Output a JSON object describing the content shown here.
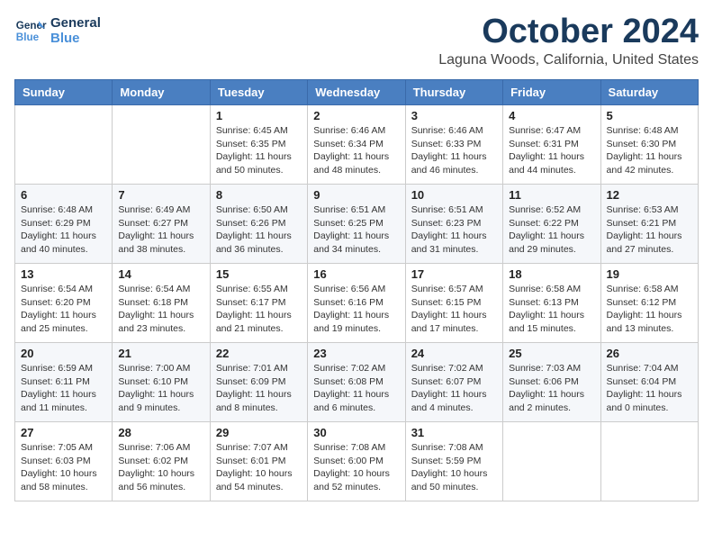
{
  "header": {
    "logo_line1": "General",
    "logo_line2": "Blue",
    "month_title": "October 2024",
    "location": "Laguna Woods, California, United States"
  },
  "days_of_week": [
    "Sunday",
    "Monday",
    "Tuesday",
    "Wednesday",
    "Thursday",
    "Friday",
    "Saturday"
  ],
  "weeks": [
    [
      null,
      null,
      {
        "day": "1",
        "sunrise": "6:45 AM",
        "sunset": "6:35 PM",
        "daylight": "11 hours and 50 minutes."
      },
      {
        "day": "2",
        "sunrise": "6:46 AM",
        "sunset": "6:34 PM",
        "daylight": "11 hours and 48 minutes."
      },
      {
        "day": "3",
        "sunrise": "6:46 AM",
        "sunset": "6:33 PM",
        "daylight": "11 hours and 46 minutes."
      },
      {
        "day": "4",
        "sunrise": "6:47 AM",
        "sunset": "6:31 PM",
        "daylight": "11 hours and 44 minutes."
      },
      {
        "day": "5",
        "sunrise": "6:48 AM",
        "sunset": "6:30 PM",
        "daylight": "11 hours and 42 minutes."
      }
    ],
    [
      {
        "day": "6",
        "sunrise": "6:48 AM",
        "sunset": "6:29 PM",
        "daylight": "11 hours and 40 minutes."
      },
      {
        "day": "7",
        "sunrise": "6:49 AM",
        "sunset": "6:27 PM",
        "daylight": "11 hours and 38 minutes."
      },
      {
        "day": "8",
        "sunrise": "6:50 AM",
        "sunset": "6:26 PM",
        "daylight": "11 hours and 36 minutes."
      },
      {
        "day": "9",
        "sunrise": "6:51 AM",
        "sunset": "6:25 PM",
        "daylight": "11 hours and 34 minutes."
      },
      {
        "day": "10",
        "sunrise": "6:51 AM",
        "sunset": "6:23 PM",
        "daylight": "11 hours and 31 minutes."
      },
      {
        "day": "11",
        "sunrise": "6:52 AM",
        "sunset": "6:22 PM",
        "daylight": "11 hours and 29 minutes."
      },
      {
        "day": "12",
        "sunrise": "6:53 AM",
        "sunset": "6:21 PM",
        "daylight": "11 hours and 27 minutes."
      }
    ],
    [
      {
        "day": "13",
        "sunrise": "6:54 AM",
        "sunset": "6:20 PM",
        "daylight": "11 hours and 25 minutes."
      },
      {
        "day": "14",
        "sunrise": "6:54 AM",
        "sunset": "6:18 PM",
        "daylight": "11 hours and 23 minutes."
      },
      {
        "day": "15",
        "sunrise": "6:55 AM",
        "sunset": "6:17 PM",
        "daylight": "11 hours and 21 minutes."
      },
      {
        "day": "16",
        "sunrise": "6:56 AM",
        "sunset": "6:16 PM",
        "daylight": "11 hours and 19 minutes."
      },
      {
        "day": "17",
        "sunrise": "6:57 AM",
        "sunset": "6:15 PM",
        "daylight": "11 hours and 17 minutes."
      },
      {
        "day": "18",
        "sunrise": "6:58 AM",
        "sunset": "6:13 PM",
        "daylight": "11 hours and 15 minutes."
      },
      {
        "day": "19",
        "sunrise": "6:58 AM",
        "sunset": "6:12 PM",
        "daylight": "11 hours and 13 minutes."
      }
    ],
    [
      {
        "day": "20",
        "sunrise": "6:59 AM",
        "sunset": "6:11 PM",
        "daylight": "11 hours and 11 minutes."
      },
      {
        "day": "21",
        "sunrise": "7:00 AM",
        "sunset": "6:10 PM",
        "daylight": "11 hours and 9 minutes."
      },
      {
        "day": "22",
        "sunrise": "7:01 AM",
        "sunset": "6:09 PM",
        "daylight": "11 hours and 8 minutes."
      },
      {
        "day": "23",
        "sunrise": "7:02 AM",
        "sunset": "6:08 PM",
        "daylight": "11 hours and 6 minutes."
      },
      {
        "day": "24",
        "sunrise": "7:02 AM",
        "sunset": "6:07 PM",
        "daylight": "11 hours and 4 minutes."
      },
      {
        "day": "25",
        "sunrise": "7:03 AM",
        "sunset": "6:06 PM",
        "daylight": "11 hours and 2 minutes."
      },
      {
        "day": "26",
        "sunrise": "7:04 AM",
        "sunset": "6:04 PM",
        "daylight": "11 hours and 0 minutes."
      }
    ],
    [
      {
        "day": "27",
        "sunrise": "7:05 AM",
        "sunset": "6:03 PM",
        "daylight": "10 hours and 58 minutes."
      },
      {
        "day": "28",
        "sunrise": "7:06 AM",
        "sunset": "6:02 PM",
        "daylight": "10 hours and 56 minutes."
      },
      {
        "day": "29",
        "sunrise": "7:07 AM",
        "sunset": "6:01 PM",
        "daylight": "10 hours and 54 minutes."
      },
      {
        "day": "30",
        "sunrise": "7:08 AM",
        "sunset": "6:00 PM",
        "daylight": "10 hours and 52 minutes."
      },
      {
        "day": "31",
        "sunrise": "7:08 AM",
        "sunset": "5:59 PM",
        "daylight": "10 hours and 50 minutes."
      },
      null,
      null
    ]
  ],
  "labels": {
    "sunrise": "Sunrise:",
    "sunset": "Sunset:",
    "daylight": "Daylight:"
  }
}
